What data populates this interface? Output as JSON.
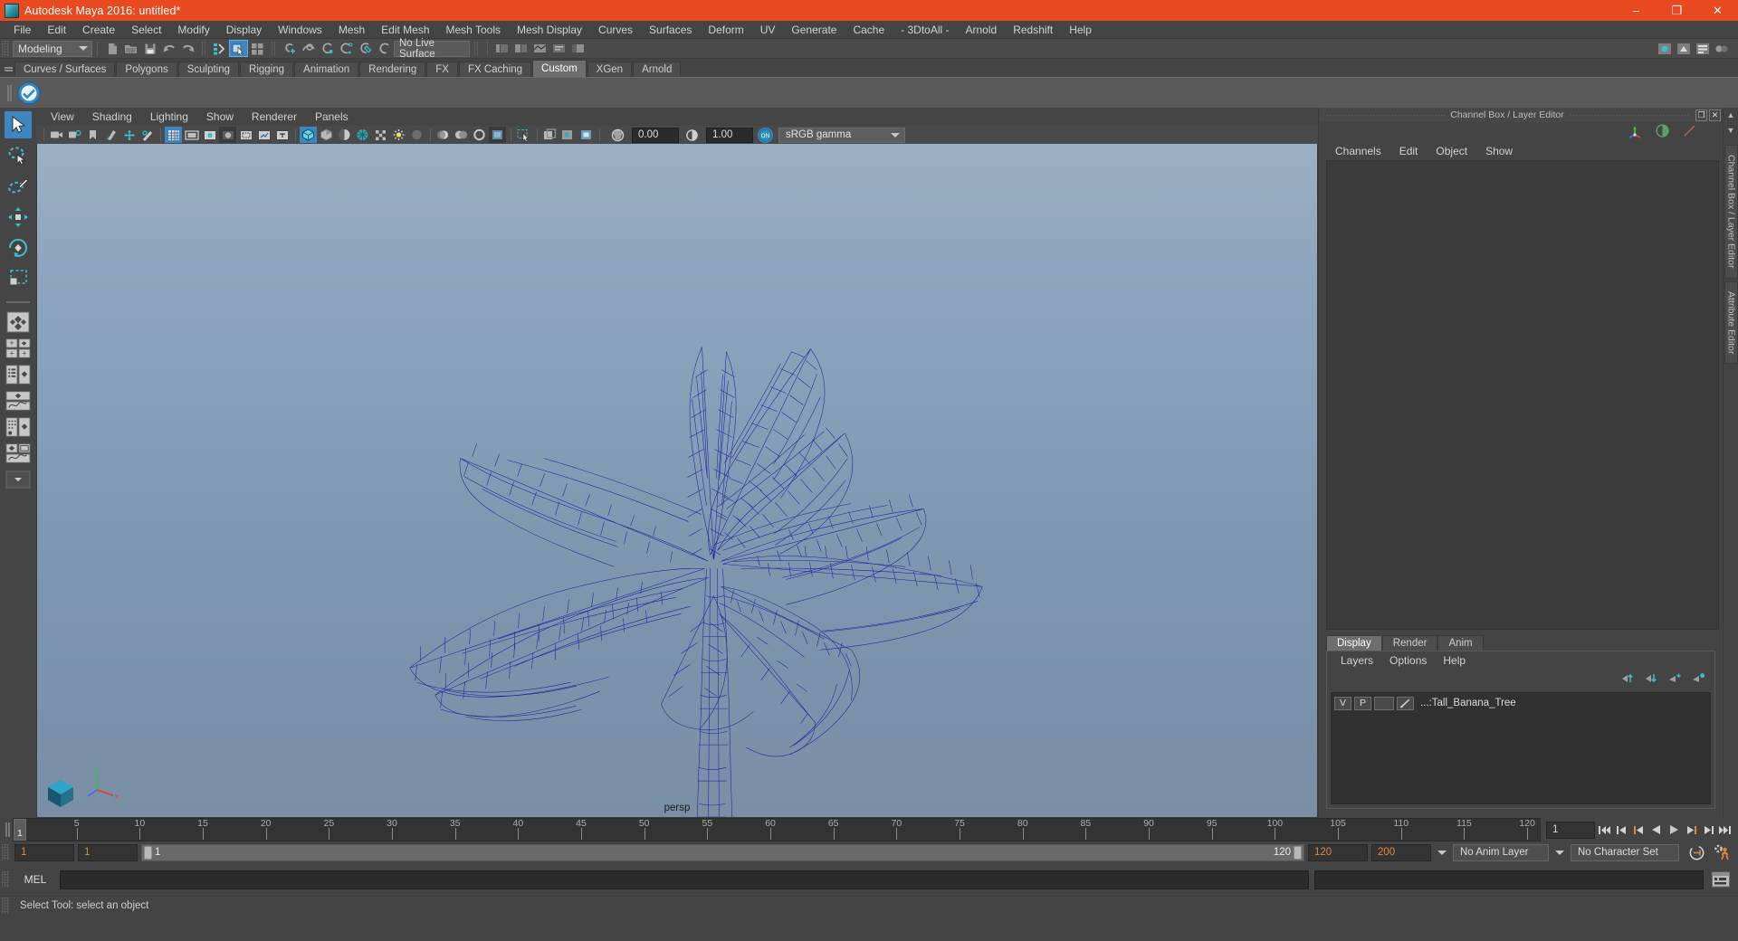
{
  "titlebar": {
    "title": "Autodesk Maya 2016: untitled*",
    "minimize": "–",
    "maximize": "❐",
    "close": "✕"
  },
  "menubar": {
    "items": [
      "File",
      "Edit",
      "Create",
      "Select",
      "Modify",
      "Display",
      "Windows",
      "Mesh",
      "Edit Mesh",
      "Mesh Tools",
      "Mesh Display",
      "Curves",
      "Surfaces",
      "Deform",
      "UV",
      "Generate",
      "Cache",
      "- 3DtoAll -",
      "Arnold",
      "Redshift",
      "Help"
    ]
  },
  "statusline": {
    "mode": "Modeling",
    "live_surface": "No Live Surface",
    "icons": [
      "new-scene-icon",
      "open-scene-icon",
      "save-scene-icon",
      "undo-icon",
      "redo-icon",
      "select-hierarchy-icon",
      "select-object-icon",
      "select-component-icon",
      "snap-grid-icon",
      "snap-curve-icon",
      "snap-point-icon",
      "snap-projected-icon",
      "snap-view-plane-icon",
      "make-live-icon",
      "show-hide-editors-icon"
    ]
  },
  "shelf": {
    "tabs": [
      "Curves / Surfaces",
      "Polygons",
      "Sculpting",
      "Rigging",
      "Animation",
      "Rendering",
      "FX",
      "FX Caching",
      "Custom",
      "XGen",
      "Arnold"
    ],
    "active_tab": "Custom",
    "items": [
      "3dtoall-badge-icon"
    ]
  },
  "toolbox": {
    "tools": [
      {
        "name": "select-tool",
        "selected": true
      },
      {
        "name": "lasso-select-tool",
        "selected": false
      },
      {
        "name": "paint-select-tool",
        "selected": false
      },
      {
        "name": "move-tool",
        "selected": false
      },
      {
        "name": "rotate-tool",
        "selected": false
      },
      {
        "name": "scale-tool",
        "selected": false
      }
    ],
    "layouts": [
      {
        "name": "single-pane-layout"
      },
      {
        "name": "four-view-layout"
      },
      {
        "name": "outliner-persp-layout"
      },
      {
        "name": "persp-graph-layout"
      },
      {
        "name": "hypershade-persp-layout"
      },
      {
        "name": "persp-graph-anim-layout"
      },
      {
        "name": "layout-more-dropdown"
      }
    ]
  },
  "viewport": {
    "menus": [
      "View",
      "Shading",
      "Lighting",
      "Show",
      "Renderer",
      "Panels"
    ],
    "camera_label": "persp",
    "exposure": "0.00",
    "gamma_value": "1.00",
    "color_profile": "sRGB gamma",
    "toolbar_icons": [
      "camera-attributes-icon",
      "camera-bookmark-icon",
      "image-plane-icon",
      "two-d-pan-zoom-icon",
      "grease-pencil-icon",
      "ipr-icon",
      "grid-toggle-icon",
      "film-gate-icon",
      "resolution-gate-icon",
      "gate-mask-icon",
      "film-origin-icon",
      "xray-icon",
      "texture-icon",
      "wireframe-icon",
      "smooth-shade-icon",
      "flat-shade-icon",
      "shaded-textured-icon",
      "use-all-lights-icon",
      "shadows-icon",
      "ao-icon",
      "motion-blur-icon",
      "isolate-select-icon",
      "xray-joints-icon",
      "exposure-icon",
      "gamma-icon",
      "view-transform-enabled-icon"
    ],
    "scene_object": "Tall Banana Tree wireframe",
    "wire_color": "#1a1a9c"
  },
  "channelbox": {
    "panel_title": "Channel Box / Layer Editor",
    "menus": [
      "Channels",
      "Edit",
      "Object",
      "Show"
    ],
    "tool_icons": [
      "channel-box-icon",
      "attribute-editor-icon",
      "modeling-toolkit-icon"
    ],
    "float_button": "❐",
    "close_button": "✕"
  },
  "layer_editor": {
    "tabs": [
      "Display",
      "Render",
      "Anim"
    ],
    "active_tab": "Display",
    "menus": [
      "Layers",
      "Options",
      "Help"
    ],
    "icons": [
      "move-layer-up-icon",
      "move-layer-down-icon",
      "new-layer-icon",
      "new-layer-from-selected-icon"
    ],
    "layers": [
      {
        "visibility": "V",
        "playback": "P",
        "color_swatch": "",
        "name": "...:Tall_Banana_Tree"
      }
    ]
  },
  "vertical_tabs": [
    "Channel Box / Layer Editor",
    "Attribute Editor"
  ],
  "timeslider": {
    "current_frame": "1",
    "ticks": [
      5,
      10,
      15,
      20,
      25,
      30,
      35,
      40,
      45,
      50,
      55,
      60,
      65,
      70,
      75,
      80,
      85,
      90,
      95,
      100,
      105,
      110,
      115,
      120
    ],
    "frame_field": "1",
    "playback_buttons": [
      "go-to-start-icon",
      "step-back-key-icon",
      "step-back-frame-icon",
      "play-backwards-icon",
      "play-forwards-icon",
      "step-forward-frame-icon",
      "step-forward-key-icon",
      "go-to-end-icon"
    ]
  },
  "rangeslider": {
    "anim_start": "1",
    "playback_start": "1",
    "range_left_label": "1",
    "range_right_label": "120",
    "playback_end": "120",
    "anim_end": "200",
    "anim_layer": "No Anim Layer",
    "character_set": "No Character Set",
    "auto_key_icon": "auto-keyframe-icon",
    "anim_prefs_icon": "animation-preferences-icon"
  },
  "commandline": {
    "language_label": "MEL",
    "input_value": "",
    "output_value": "",
    "script_editor_icon": "script-editor-icon"
  },
  "helpline": {
    "message": "Select Tool: select an object"
  },
  "colors": {
    "title_bar": "#e8491e",
    "accent_blue": "#3e86c2",
    "panel_bg": "#444444",
    "field_bg": "#2b2b2b",
    "orange_text": "#e08a3c"
  }
}
